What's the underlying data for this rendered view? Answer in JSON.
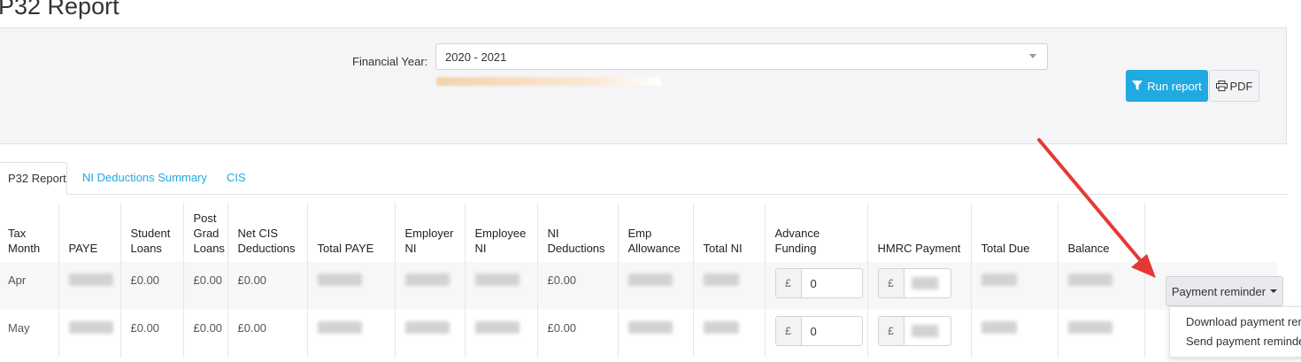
{
  "page": {
    "title": "P32 Report"
  },
  "filters": {
    "financial_year_label": "Financial Year:",
    "financial_year_value": "2020 - 2021"
  },
  "actions": {
    "run_report_label": "Run report",
    "pdf_label": "PDF"
  },
  "tabs": [
    {
      "label": "P32 Report",
      "active": true
    },
    {
      "label": "NI Deductions Summary",
      "active": false
    },
    {
      "label": "CIS",
      "active": false
    }
  ],
  "table": {
    "headers": {
      "tax_month": [
        "Tax",
        "Month"
      ],
      "paye": [
        "PAYE"
      ],
      "student_loans": [
        "Student",
        "Loans"
      ],
      "post_grad_loans": [
        "Post",
        "Grad",
        "Loans"
      ],
      "net_cis": [
        "Net CIS",
        "Deductions"
      ],
      "total_paye": [
        "Total PAYE"
      ],
      "employer_ni": [
        "Employer",
        "NI"
      ],
      "employee_ni": [
        "Employee",
        "NI"
      ],
      "ni_deductions": [
        "NI",
        "Deductions"
      ],
      "emp_allowance": [
        "Emp",
        "Allowance"
      ],
      "total_ni": [
        "Total NI"
      ],
      "advance_funding": [
        "Advance",
        "Funding"
      ],
      "hmrc_payment": [
        "HMRC Payment"
      ],
      "total_due": [
        "Total Due"
      ],
      "balance": [
        "Balance"
      ]
    },
    "rows": [
      {
        "month": "Apr",
        "student_loans": "£0.00",
        "post_grad_loans": "£0.00",
        "net_cis": "£0.00",
        "ni_deductions": "£0.00",
        "advance_funding": "0",
        "currency": "£"
      },
      {
        "month": "May",
        "student_loans": "£0.00",
        "post_grad_loans": "£0.00",
        "net_cis": "£0.00",
        "ni_deductions": "£0.00",
        "advance_funding": "0",
        "currency": "£"
      }
    ]
  },
  "payment_reminder": {
    "button_label": "Payment reminder",
    "menu": [
      "Download payment rer",
      "Send payment reminde"
    ]
  },
  "colors": {
    "accent": "#21a9e1",
    "annotation_arrow": "#e53935"
  }
}
